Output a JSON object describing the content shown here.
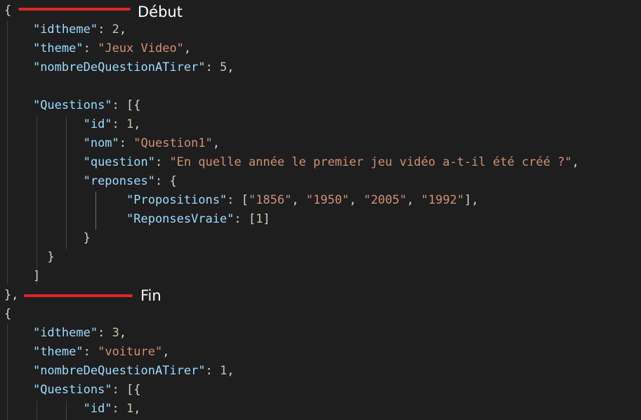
{
  "colors": {
    "background": "#1e1e1e",
    "key": "#9cdcfe",
    "string": "#ce9178",
    "number": "#b5cea8",
    "punctuation": "#d4d4d4",
    "annotation_line": "#e0242b",
    "annotation_text": "#ffffff"
  },
  "annotations": {
    "start_label": "Début",
    "end_label": "Fin"
  },
  "code": {
    "l1_open": "{",
    "l2_key": "\"idtheme\"",
    "l2_val": "2",
    "l3_key": "\"theme\"",
    "l3_val": "\"Jeux Video\"",
    "l4_key": "\"nombreDeQuestionATirer\"",
    "l4_val": "5",
    "l6_key": "\"Questions\"",
    "l6_open": "[{",
    "l7_key": "\"id\"",
    "l7_val": "1",
    "l8_key": "\"nom\"",
    "l8_val": "\"Question1\"",
    "l9_key": "\"question\"",
    "l9_val": "\"En quelle année le premier jeu vidéo a-t-il été créé ?\"",
    "l10_key": "\"reponses\"",
    "l10_open": "{",
    "l11_key": "\"Propositions\"",
    "l11_v1": "\"1856\"",
    "l11_v2": "\"1950\"",
    "l11_v3": "\"2005\"",
    "l11_v4": "\"1992\"",
    "l12_key": "\"ReponsesVraie\"",
    "l12_val": "1",
    "l13_close": "}",
    "l14_close": "}",
    "l15_close": "]",
    "l16_close": "},",
    "l17_open": "{",
    "l18_key": "\"idtheme\"",
    "l18_val": "3",
    "l19_key": "\"theme\"",
    "l19_val": "\"voiture\"",
    "l20_key": "\"nombreDeQuestionATirer\"",
    "l20_val": "1",
    "l21_key": "\"Questions\"",
    "l21_open": "[{",
    "l22_key": "\"id\"",
    "l22_val": "1"
  }
}
